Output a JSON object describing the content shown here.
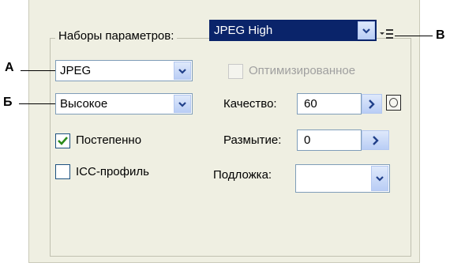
{
  "presets": {
    "label": "Наборы параметров:",
    "value": "JPEG High"
  },
  "format": {
    "value": "JPEG"
  },
  "quality_preset": {
    "value": "Высокое"
  },
  "optimized": {
    "label": "Оптимизированное",
    "checked": false,
    "enabled": false
  },
  "quality": {
    "label": "Качество:",
    "value": "60"
  },
  "blur": {
    "label": "Размытие:",
    "value": "0"
  },
  "matte": {
    "label": "Подложка:",
    "value": ""
  },
  "progressive": {
    "label": "Постепенно",
    "checked": true
  },
  "icc": {
    "label": "ICC-профиль",
    "checked": false
  },
  "callouts": {
    "a": "А",
    "b": "Б",
    "c": "В"
  },
  "colors": {
    "panel_bg": "#efefe2",
    "selection": "#0a246a",
    "check": "#2a8a1a"
  }
}
